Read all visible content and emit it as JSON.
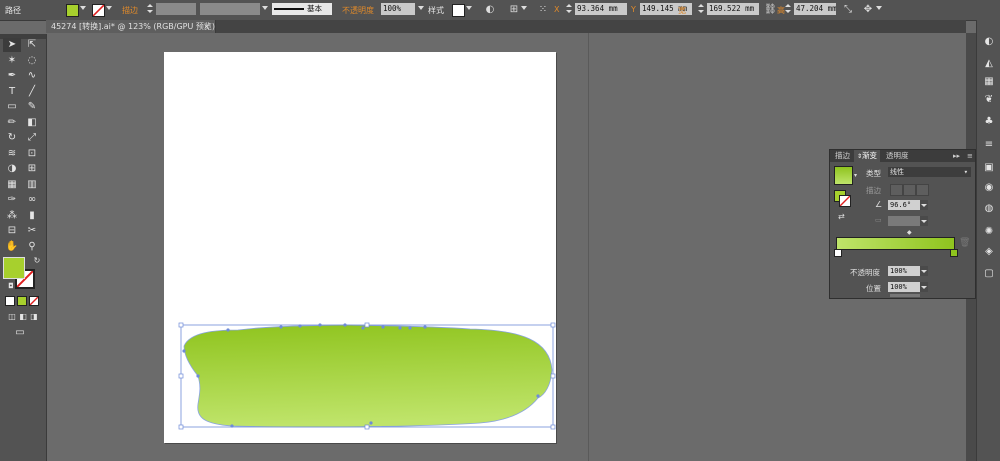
{
  "colors": {
    "fill_swatch": "#a7d02d",
    "grad_start": "#bfe46a",
    "grad_end": "#8fc41e",
    "selection": "#6f8cd8"
  },
  "control_bar": {
    "selection_type": "路径",
    "stroke_label": "描边",
    "stroke_style_label": "基本",
    "opacity_label": "不透明度",
    "opacity_value": "100%",
    "style_label": "样式",
    "x_label": "X",
    "x_value": "93.364 mm",
    "y_label": "Y",
    "y_value": "149.145 mm",
    "w_label": "宽",
    "w_value": "169.522 mm",
    "h_label": "高",
    "h_value": "47.204 mm"
  },
  "document_tab": {
    "title": "45274 [转换].ai* @ 123% (RGB/GPU 预览)",
    "close": "×"
  },
  "gradient_panel": {
    "tabs": [
      "描边",
      "渐变",
      "透明度"
    ],
    "active_tab": 1,
    "type_label": "类型",
    "type_value": "线性",
    "stroke_label": "描边",
    "angle_value": "96.6°",
    "opacity_label": "不透明度",
    "opacity_value": "100%",
    "position_label": "位置",
    "position_value": "100%"
  },
  "icons": {
    "tools": [
      "selection-icon",
      "direct-selection-icon",
      "magic-wand-icon",
      "lasso-icon",
      "pen-icon",
      "curvature-icon",
      "type-icon",
      "line-segment-icon",
      "rectangle-icon",
      "paintbrush-icon",
      "pencil-icon",
      "eraser-icon",
      "rotate-icon",
      "scale-icon",
      "width-icon",
      "free-transform-icon",
      "shape-builder-icon",
      "perspective-grid-icon",
      "mesh-icon",
      "gradient-icon",
      "eyedropper-icon",
      "blend-icon",
      "symbol-sprayer-icon",
      "column-graph-icon",
      "artboard-icon",
      "slice-icon",
      "hand-icon",
      "zoom-icon"
    ],
    "dock": [
      "color-icon",
      "color-guide-icon",
      "swatches-icon",
      "brushes-icon",
      "symbols-icon",
      "stroke-icon",
      "gradient-icon",
      "transparency-icon",
      "appearance-icon",
      "graphic-styles-icon",
      "layers-icon",
      "artboards-icon"
    ]
  }
}
